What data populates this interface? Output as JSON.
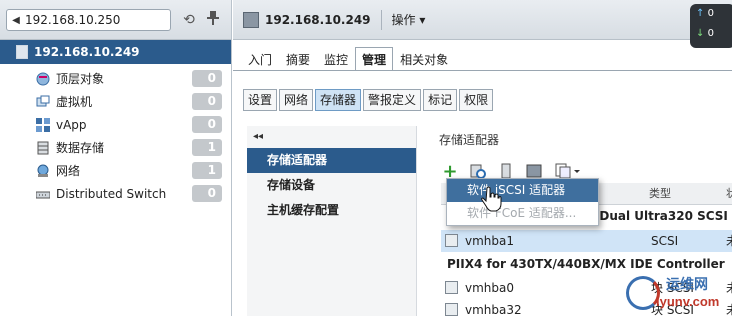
{
  "nav": {
    "history_value": "192.168.10.250",
    "host_label": "192.168.10.249",
    "items": [
      {
        "label": "顶层对象",
        "count": "0",
        "icon": "top-object-icon"
      },
      {
        "label": "虚拟机",
        "count": "0",
        "icon": "vm-icon"
      },
      {
        "label": "vApp",
        "count": "0",
        "icon": "vapp-icon"
      },
      {
        "label": "数据存储",
        "count": "1",
        "icon": "datastore-icon"
      },
      {
        "label": "网络",
        "count": "1",
        "icon": "network-icon"
      },
      {
        "label": "Distributed Switch",
        "count": "0",
        "icon": "distributed-switch-icon"
      }
    ]
  },
  "header": {
    "title": "192.168.10.249",
    "actions_label": "操作 ▾",
    "status_up": "0",
    "status_down": "0"
  },
  "tabs": [
    "入门",
    "摘要",
    "监控",
    "管理",
    "相关对象"
  ],
  "subtabs": [
    "设置",
    "网络",
    "存储器",
    "警报定义",
    "标记",
    "权限"
  ],
  "side_collapse": "◂◂",
  "side_items": [
    "存储适配器",
    "存储设备",
    "主机缓存配置"
  ],
  "content": {
    "title": "存储适配器",
    "table": {
      "group1_tail": "T Dual Ultra320 SCSI",
      "type_header": "类型",
      "status_header_fragment": "状",
      "group2": "PIIX4 for 430TX/440BX/MX IDE Controller",
      "rows": [
        {
          "name": "vmhba1",
          "type": "SCSI",
          "status": "未"
        },
        {
          "name": "vmhba0",
          "type": "块 SCSI",
          "status": "未"
        },
        {
          "name": "vmhba32",
          "type": "块 SCSI",
          "status": "未"
        }
      ]
    }
  },
  "menu": {
    "item1": "软件 iSCSI 适配器",
    "item2": "软件 FCoE 适配器..."
  },
  "watermark": {
    "line1": "运维网",
    "line2": "iyunv.com"
  },
  "colors": {
    "nav_selected": "#2b5b8c",
    "menu_highlight": "#3f6f9e",
    "subtab_active": "#cfe3f5"
  }
}
